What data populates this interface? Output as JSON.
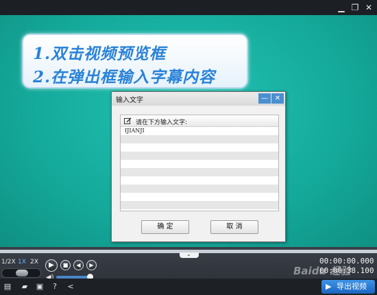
{
  "window": {
    "minimize_icon": "minimize-icon",
    "maximize_icon": "restore-icon",
    "close_icon": "close-icon"
  },
  "callout": {
    "line1": "1.双击视频预览框",
    "line2": "2.在弹出框输入字幕内容"
  },
  "dialog": {
    "title": "输入文字",
    "prompt": "请在下方输入文字:",
    "text_value": "IJIANJI",
    "ok_label": "确 定",
    "cancel_label": "取 消"
  },
  "playback": {
    "speeds": [
      "1/2X",
      "1X",
      "2X"
    ],
    "selected_speed": "1X",
    "current_time": "00:00:00.000",
    "total_time": "00:00:38.100"
  },
  "bottom_bar": {
    "export_label": "导出视频"
  },
  "watermark": "Baidu 经验",
  "colors": {
    "preview_bg": "#14a99a",
    "accent": "#2a82d8",
    "export_button": "#1b66c0"
  }
}
